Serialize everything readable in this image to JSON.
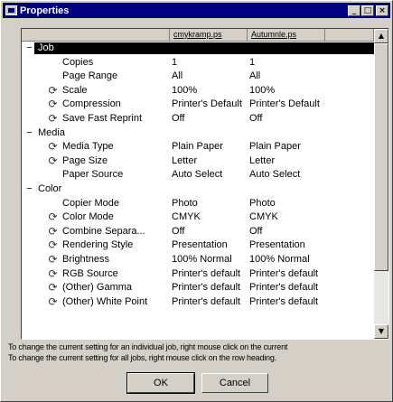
{
  "window": {
    "title": "Properties",
    "controls": {
      "minimize": "_",
      "maximize": "□",
      "close": "×"
    }
  },
  "grid": {
    "columns": [
      "",
      "cmykramp.ps",
      "Autumnle.ps",
      ""
    ],
    "rows": [
      {
        "type": "group",
        "toggle": "−",
        "name": "Job",
        "selected": true
      },
      {
        "type": "item",
        "icon": false,
        "label": "Copies",
        "v1": "1",
        "v2": "1"
      },
      {
        "type": "item",
        "icon": false,
        "label": "Page Range",
        "v1": "All",
        "v2": "All"
      },
      {
        "type": "item",
        "icon": true,
        "label": "Scale",
        "v1": "100%",
        "v2": "100%"
      },
      {
        "type": "item",
        "icon": true,
        "label": "Compression",
        "v1": "Printer's Default",
        "v2": "Printer's Default"
      },
      {
        "type": "item",
        "icon": true,
        "label": "Save Fast Reprint",
        "v1": "Off",
        "v2": "Off"
      },
      {
        "type": "group",
        "toggle": "−",
        "name": "Media",
        "selected": false
      },
      {
        "type": "item",
        "icon": true,
        "label": "Media Type",
        "v1": "Plain Paper",
        "v2": "Plain Paper"
      },
      {
        "type": "item",
        "icon": true,
        "label": "Page Size",
        "v1": "Letter",
        "v2": "Letter"
      },
      {
        "type": "item",
        "icon": false,
        "label": "Paper Source",
        "v1": "Auto Select",
        "v2": "Auto Select"
      },
      {
        "type": "group",
        "toggle": "−",
        "name": "Color",
        "selected": false
      },
      {
        "type": "item",
        "icon": false,
        "label": "Copier Mode",
        "v1": "Photo",
        "v2": "Photo"
      },
      {
        "type": "item",
        "icon": true,
        "label": "Color Mode",
        "v1": "CMYK",
        "v2": "CMYK"
      },
      {
        "type": "item",
        "icon": true,
        "label": "Combine Separa...",
        "v1": "Off",
        "v2": "Off"
      },
      {
        "type": "item",
        "icon": true,
        "label": "Rendering Style",
        "v1": "Presentation",
        "v2": "Presentation"
      },
      {
        "type": "item",
        "icon": true,
        "label": "Brightness",
        "v1": "100% Normal",
        "v2": "100% Normal"
      },
      {
        "type": "item",
        "icon": true,
        "label": "RGB Source",
        "v1": "Printer's default",
        "v2": "Printer's default"
      },
      {
        "type": "item",
        "icon": true,
        "label": "(Other) Gamma",
        "v1": "Printer's default",
        "v2": "Printer's default"
      },
      {
        "type": "item",
        "icon": true,
        "label": "(Other) White Point",
        "v1": "Printer's default",
        "v2": "Printer's default"
      }
    ],
    "row_icon": "refresh-icon",
    "scroll": {
      "up": "▲",
      "down": "▼"
    }
  },
  "help": {
    "line1": "To change the current setting for an individual job, right mouse click on the current",
    "line2": "To change the current setting for all jobs, right mouse click on the row heading."
  },
  "buttons": {
    "ok": "OK",
    "cancel": "Cancel"
  }
}
